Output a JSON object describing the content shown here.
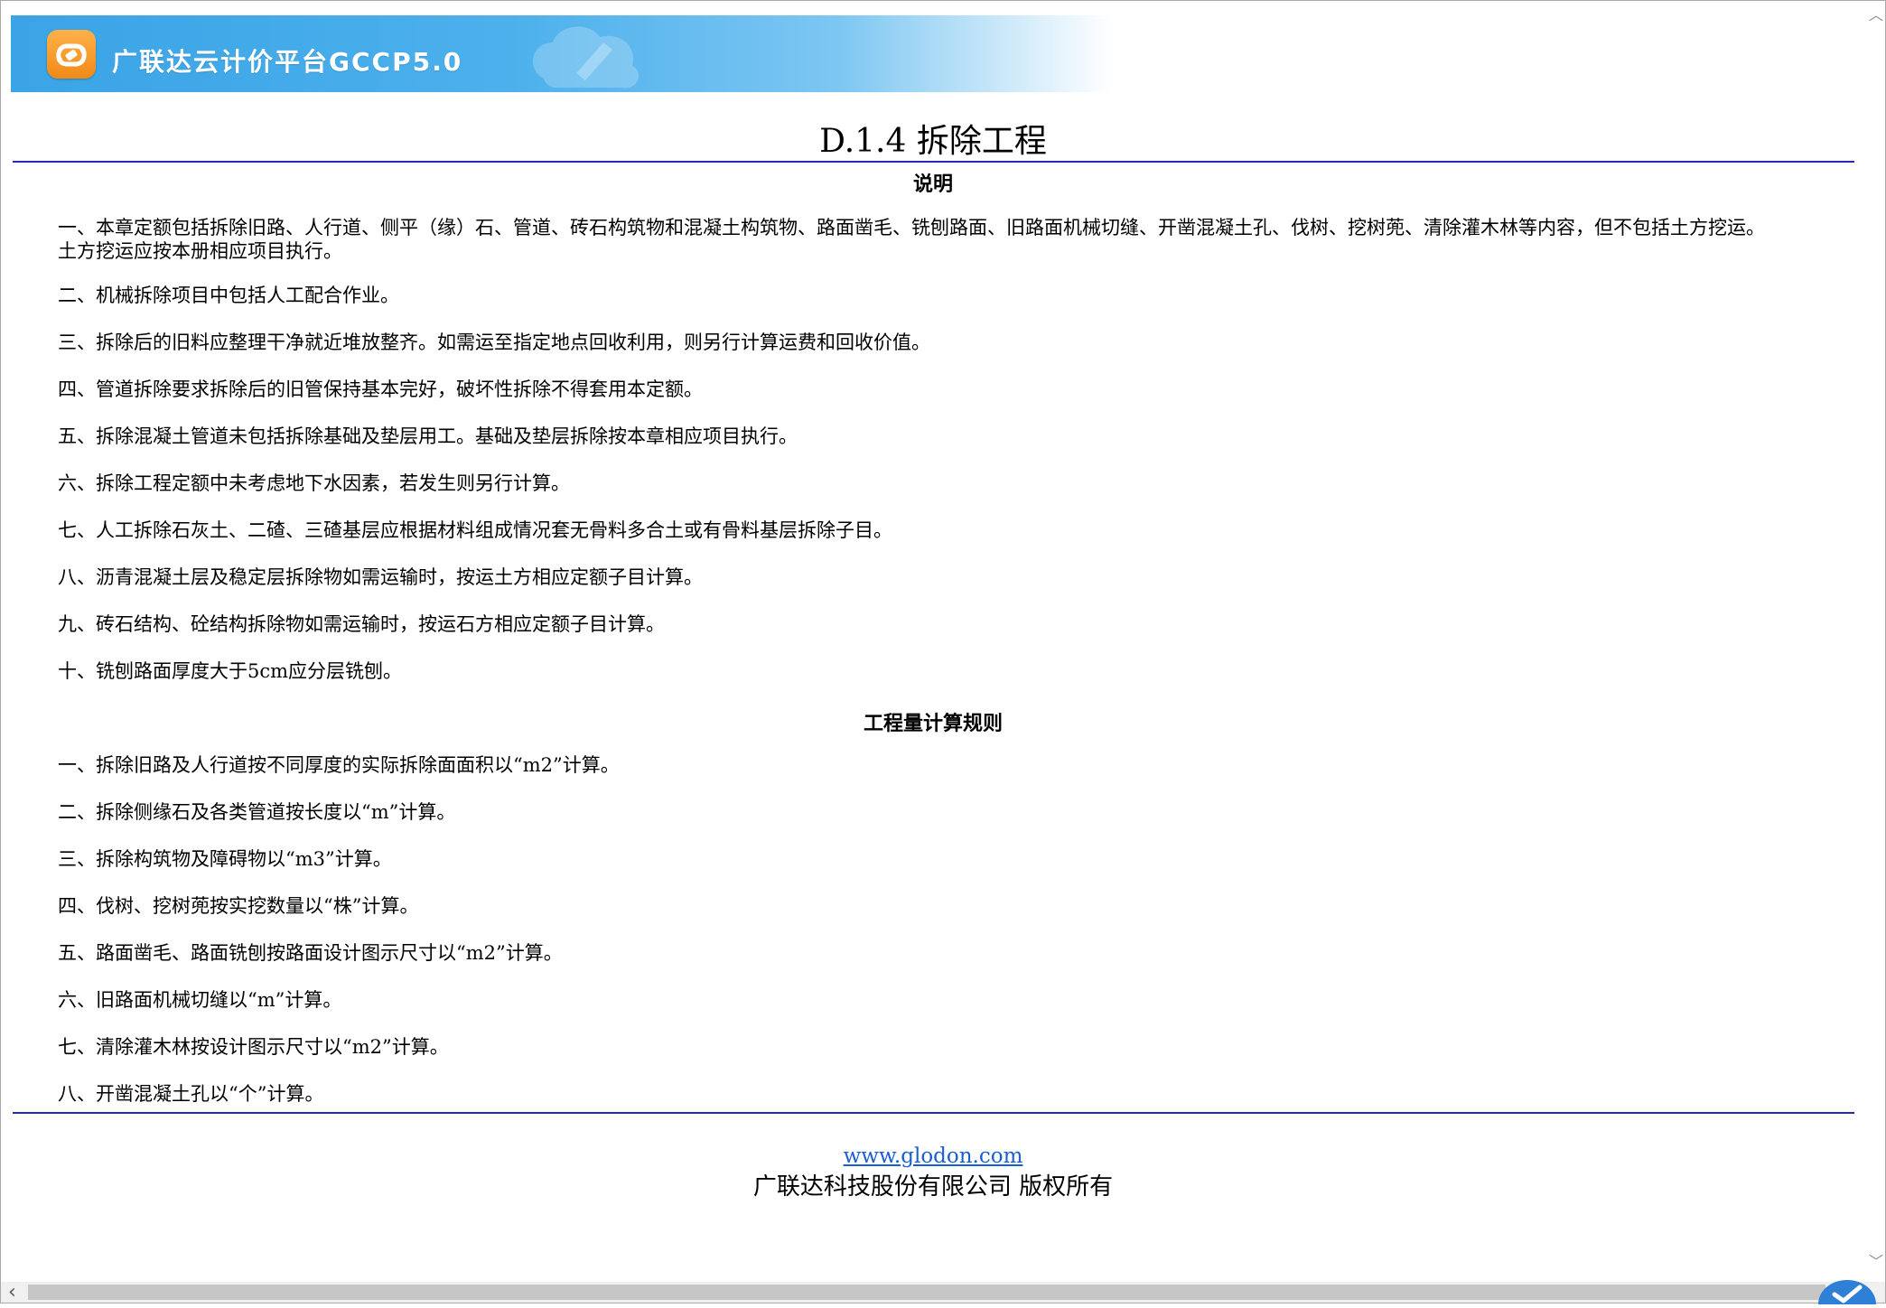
{
  "header": {
    "app_title": "广联达云计价平台GCCP5.0",
    "logo_icon": "glodon-logo-icon",
    "brand_color": "#3aa4e6"
  },
  "page": {
    "title": "D.1.4 拆除工程"
  },
  "explanation": {
    "heading": "说明",
    "items": [
      "一、本章定额包括拆除旧路、人行道、侧平（缘）石、管道、砖石构筑物和混凝土构筑物、路面凿毛、铣刨路面、旧路面机械切缝、开凿混凝土孔、伐树、挖树蔸、清除灌木林等内容，但不包括土方挖运。土方挖运应按本册相应项目执行。",
      "二、机械拆除项目中包括人工配合作业。",
      "三、拆除后的旧料应整理干净就近堆放整齐。如需运至指定地点回收利用，则另行计算运费和回收价值。",
      "四、管道拆除要求拆除后的旧管保持基本完好，破坏性拆除不得套用本定额。",
      "五、拆除混凝土管道未包括拆除基础及垫层用工。基础及垫层拆除按本章相应项目执行。",
      "六、拆除工程定额中未考虑地下水因素，若发生则另行计算。",
      "七、人工拆除石灰土、二碴、三碴基层应根据材料组成情况套无骨料多合土或有骨料基层拆除子目。",
      "八、沥青混凝土层及稳定层拆除物如需运输时，按运土方相应定额子目计算。",
      "九、砖石结构、砼结构拆除物如需运输时，按运石方相应定额子目计算。",
      "十、铣刨路面厚度大于5cm应分层铣刨。"
    ]
  },
  "rules": {
    "heading": "工程量计算规则",
    "items": [
      "一、拆除旧路及人行道按不同厚度的实际拆除面面积以“m2”计算。",
      "二、拆除侧缘石及各类管道按长度以“m”计算。",
      "三、拆除构筑物及障碍物以“m3”计算。",
      "四、伐树、挖树蔸按实挖数量以“株”计算。",
      "五、路面凿毛、路面铣刨按路面设计图示尺寸以“m2”计算。",
      "六、旧路面机械切缝以“m”计算。",
      "七、清除灌木林按设计图示尺寸以“m2”计算。",
      "八、开凿混凝土孔以“个”计算。"
    ]
  },
  "footer": {
    "link_text": "www.glodon.com",
    "copyright": "广联达科技股份有限公司 版权所有"
  },
  "colors": {
    "rule": "#2828b8",
    "link": "#1a5fd1"
  }
}
